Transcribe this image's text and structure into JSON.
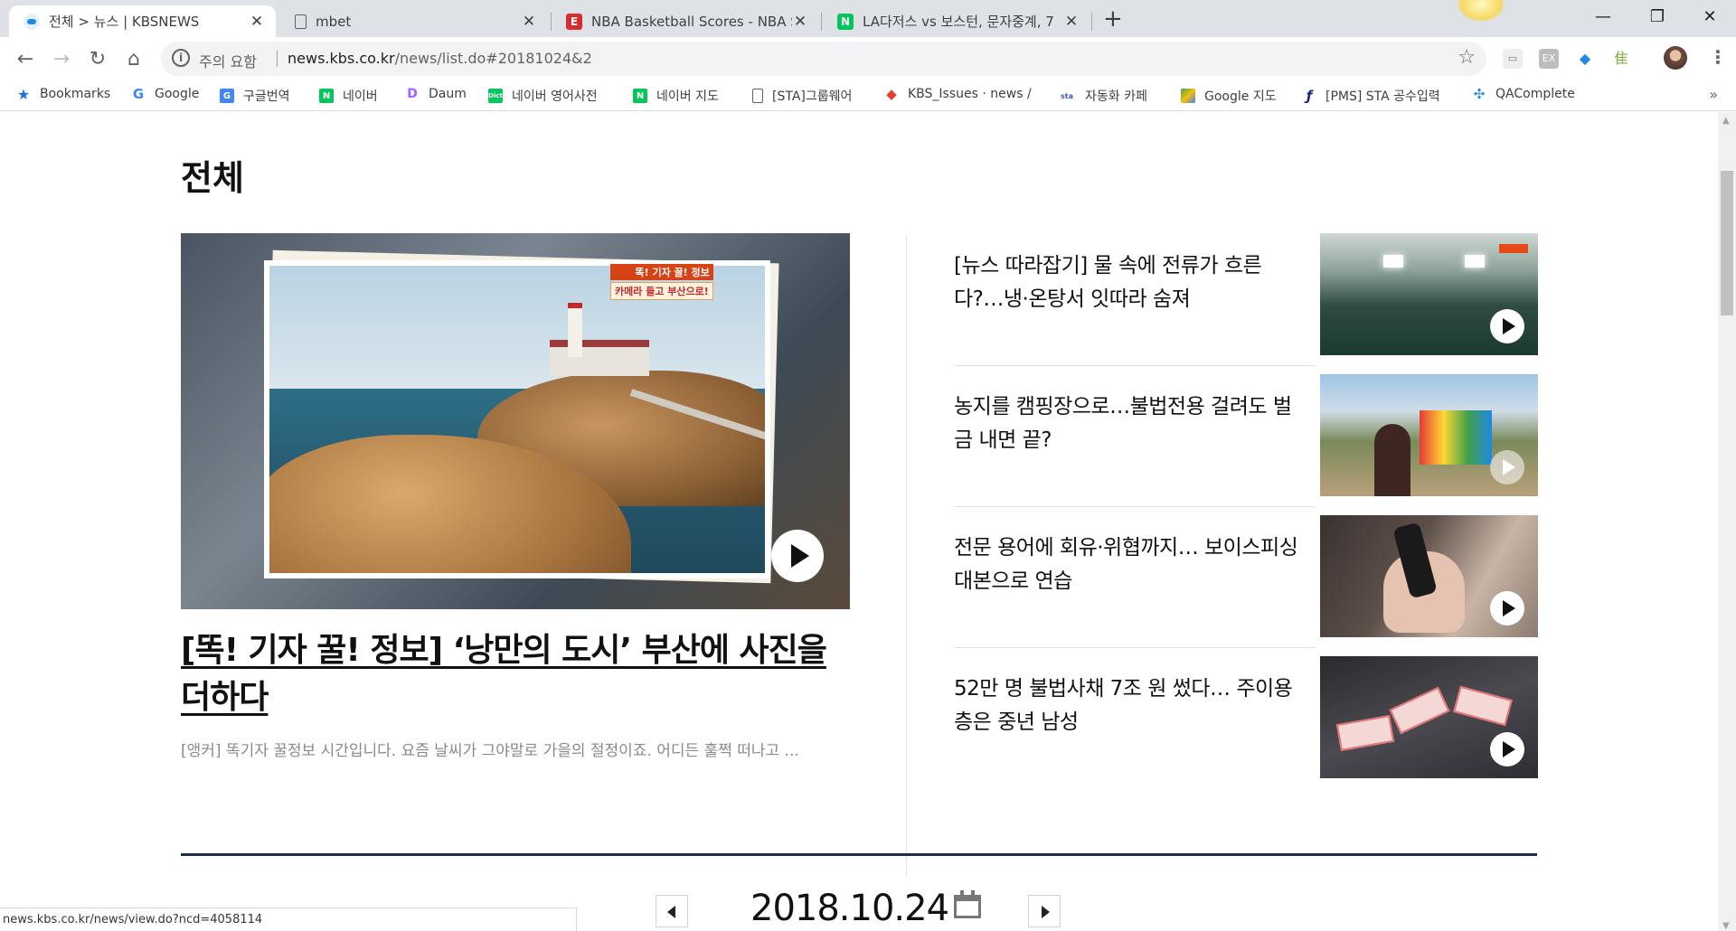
{
  "browser": {
    "tabs": [
      {
        "title": "전체 > 뉴스 | KBSNEWS",
        "active": true,
        "favicon": "kbs-icon",
        "color": "#1e88e5"
      },
      {
        "title": "mbet",
        "active": false,
        "favicon": "page-icon",
        "color": "#9aa0a6"
      },
      {
        "title": "NBA Basketball Scores - NBA Sc",
        "active": false,
        "favicon": "espn-icon",
        "color": "#d32f2f"
      },
      {
        "title": "LA다저스 vs 보스턴, 문자중계, 7",
        "active": false,
        "favicon": "naver-icon",
        "color": "#03c75a"
      }
    ],
    "new_tab": "+",
    "window_controls": {
      "minimize": "—",
      "restore": "❐",
      "close": "✕"
    },
    "address_bar": {
      "security_label": "주의 요함",
      "url_domain": "news.kbs.co.kr",
      "url_path": "/news/list.do#20181024&2"
    },
    "bookmarks": [
      {
        "label": "Bookmarks",
        "icon": "star-icon",
        "color": "#1a73e8"
      },
      {
        "label": "Google",
        "icon": "google-icon",
        "color": "#4285f4"
      },
      {
        "label": "구글번역",
        "icon": "translate-icon",
        "color": "#4285f4"
      },
      {
        "label": "네이버",
        "icon": "naver-icon",
        "color": "#03c75a"
      },
      {
        "label": "Daum",
        "icon": "daum-icon",
        "color": "#a260ff"
      },
      {
        "label": "네이버 영어사전",
        "icon": "dict-icon",
        "color": "#03c75a"
      },
      {
        "label": "네이버 지도",
        "icon": "naver-icon",
        "color": "#03c75a"
      },
      {
        "label": "[STA]그룹웨어",
        "icon": "page-icon",
        "color": "#9aa0a6"
      },
      {
        "label": "KBS_Issues · news / ",
        "icon": "gitlab-icon",
        "color": "#e24329"
      },
      {
        "label": "자동화 카페",
        "icon": "sta-icon",
        "color": "#3f51b5"
      },
      {
        "label": "Google 지도",
        "icon": "maps-icon",
        "color": "#34a853"
      },
      {
        "label": "[PMS] STA 공수입력",
        "icon": "pms-icon",
        "color": "#1a237e"
      },
      {
        "label": "QAComplete",
        "icon": "qa-icon",
        "color": "#1e88e5"
      }
    ],
    "bookmarks_more": "»",
    "status_url": "news.kbs.co.kr/news/view.do?ncd=4058114"
  },
  "page": {
    "section_title": "전체",
    "main_article": {
      "badge_line1": "똑! 기자 꿀! 정보",
      "badge_line2": "카메라 들고 부산으로!",
      "headline": "[똑! 기자 꿀! 정보] ‘낭만의 도시’ 부산에 사진을 더하다",
      "summary": "[앵커] 똑기자 꿀정보 시간입니다. 요즘 날씨가 그야말로 가을의 절정이죠. 어디든 훌쩍 떠나고 ..."
    },
    "side_articles": [
      {
        "headline": "[뉴스 따라잡기] 물 속에 전류가 흐른다?…냉·온탕서 잇따라 숨져"
      },
      {
        "headline": "농지를 캠핑장으로…불법전용 걸려도 벌금 내면 끝?"
      },
      {
        "headline": "전문 용어에 회유·위협까지… 보이스피싱 대본으로 연습"
      },
      {
        "headline": "52만 명 불법사채 7조 원 썼다… 주이용층은 중년 남성"
      }
    ],
    "date": "2018.10.24"
  },
  "colors": {
    "accent_navy": "#1f2a4c",
    "tab_strip": "#dee1e6"
  }
}
